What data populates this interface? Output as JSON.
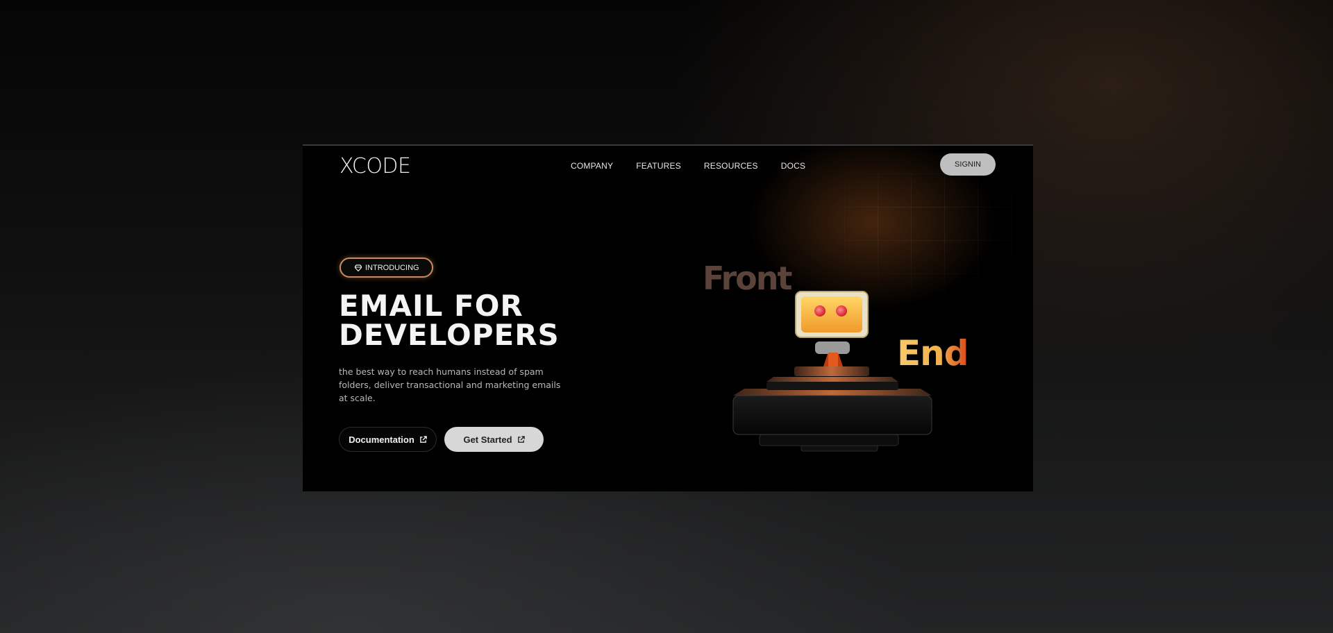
{
  "brand": {
    "logo": "XCODE"
  },
  "nav": {
    "items": [
      {
        "label": "COMPANY"
      },
      {
        "label": "FEATURES"
      },
      {
        "label": "RESOURCES"
      },
      {
        "label": "DOCS"
      }
    ],
    "signin_label": "SIGNIN"
  },
  "hero": {
    "badge": "INTRODUCING",
    "headline_line1": "EMAIL FOR",
    "headline_line2": "DEVELOPERS",
    "description": "the best way to reach humans instead of spam folders, deliver transactional and marketing emails at scale.",
    "primary_button": "Documentation",
    "secondary_button": "Get Started"
  },
  "illustration": {
    "word_front": "Front",
    "word_end": "End"
  },
  "colors": {
    "badge_border": "#c98c62",
    "accent_orange": "#f2b24c",
    "signin_bg": "#bfbfbf",
    "get_started_bg": "#d7d7d7"
  },
  "icons": {
    "badge": "gem-icon",
    "buttons": "external-link-icon"
  }
}
